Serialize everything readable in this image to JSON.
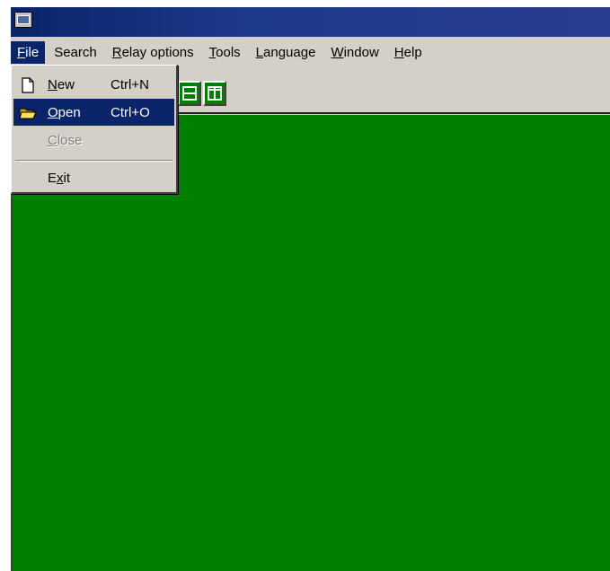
{
  "window": {
    "title_text": ""
  },
  "menubar": {
    "items": [
      {
        "label_mn": "F",
        "label_rest": "ile"
      },
      {
        "label_pre": "Se",
        "label_mn": "",
        "label_rest": "arch"
      },
      {
        "label_mn": "R",
        "label_rest": "elay options"
      },
      {
        "label_mn": "T",
        "label_rest": "ools"
      },
      {
        "label_mn": "L",
        "label_rest": "anguage"
      },
      {
        "label_mn": "W",
        "label_rest": "indow"
      },
      {
        "label_mn": "H",
        "label_rest": "elp"
      }
    ]
  },
  "file_menu": {
    "new": {
      "mn": "N",
      "rest": "ew",
      "shortcut": "Ctrl+N",
      "icon": "new-document-icon"
    },
    "open": {
      "mn": "O",
      "rest": "pen",
      "shortcut": "Ctrl+O",
      "icon": "open-folder-icon"
    },
    "close": {
      "mn": "C",
      "rest": "lose"
    },
    "exit": {
      "pre": "E",
      "mn": "x",
      "rest": "it"
    }
  },
  "colors": {
    "mdi_background": "#008000",
    "highlight": "#0a246a",
    "face": "#d4d0c8"
  }
}
